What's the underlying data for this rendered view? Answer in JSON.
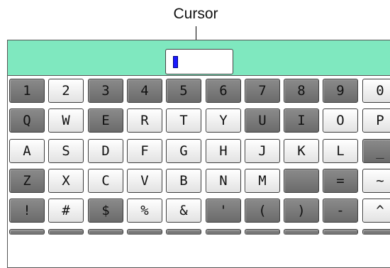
{
  "callout": {
    "label": "Cursor"
  },
  "colors": {
    "top_bar": "#7fe8bf",
    "cursor": "#1a1aff",
    "dark_key": "#777777",
    "light_key": "#f2f2f2"
  },
  "input": {
    "value": ""
  },
  "keyboard": {
    "rows": [
      {
        "keys": [
          {
            "label": "1",
            "style": "dark"
          },
          {
            "label": "2",
            "style": "light"
          },
          {
            "label": "3",
            "style": "dark"
          },
          {
            "label": "4",
            "style": "dark"
          },
          {
            "label": "5",
            "style": "dark"
          },
          {
            "label": "6",
            "style": "dark"
          },
          {
            "label": "7",
            "style": "dark"
          },
          {
            "label": "8",
            "style": "dark"
          },
          {
            "label": "9",
            "style": "dark"
          },
          {
            "label": "0",
            "style": "light"
          }
        ]
      },
      {
        "keys": [
          {
            "label": "Q",
            "style": "dark"
          },
          {
            "label": "W",
            "style": "light"
          },
          {
            "label": "E",
            "style": "dark"
          },
          {
            "label": "R",
            "style": "light"
          },
          {
            "label": "T",
            "style": "light"
          },
          {
            "label": "Y",
            "style": "light"
          },
          {
            "label": "U",
            "style": "dark"
          },
          {
            "label": "I",
            "style": "dark"
          },
          {
            "label": "O",
            "style": "light"
          },
          {
            "label": "P",
            "style": "light"
          }
        ]
      },
      {
        "keys": [
          {
            "label": "A",
            "style": "light"
          },
          {
            "label": "S",
            "style": "light"
          },
          {
            "label": "D",
            "style": "light"
          },
          {
            "label": "F",
            "style": "light"
          },
          {
            "label": "G",
            "style": "light"
          },
          {
            "label": "H",
            "style": "light"
          },
          {
            "label": "J",
            "style": "light"
          },
          {
            "label": "K",
            "style": "light"
          },
          {
            "label": "L",
            "style": "light"
          },
          {
            "label": "_",
            "style": "dark"
          }
        ]
      },
      {
        "keys": [
          {
            "label": "Z",
            "style": "dark"
          },
          {
            "label": "X",
            "style": "light"
          },
          {
            "label": "C",
            "style": "light"
          },
          {
            "label": "V",
            "style": "light"
          },
          {
            "label": "B",
            "style": "light"
          },
          {
            "label": "N",
            "style": "light"
          },
          {
            "label": "M",
            "style": "light"
          },
          {
            "label": "",
            "style": "dark"
          },
          {
            "label": "=",
            "style": "dark"
          },
          {
            "label": "~",
            "style": "light"
          }
        ]
      },
      {
        "keys": [
          {
            "label": "!",
            "style": "dark"
          },
          {
            "label": "#",
            "style": "light"
          },
          {
            "label": "$",
            "style": "dark"
          },
          {
            "label": "%",
            "style": "light"
          },
          {
            "label": "&",
            "style": "light"
          },
          {
            "label": "'",
            "style": "dark"
          },
          {
            "label": "(",
            "style": "dark"
          },
          {
            "label": ")",
            "style": "dark"
          },
          {
            "label": "-",
            "style": "dark"
          },
          {
            "label": "^",
            "style": "light"
          }
        ]
      },
      {
        "keys": [
          {
            "label": "",
            "style": "dark"
          },
          {
            "label": "",
            "style": "dark"
          },
          {
            "label": "",
            "style": "dark"
          },
          {
            "label": "",
            "style": "dark"
          },
          {
            "label": "",
            "style": "dark"
          },
          {
            "label": "",
            "style": "dark"
          },
          {
            "label": "",
            "style": "dark"
          },
          {
            "label": "",
            "style": "dark"
          },
          {
            "label": "",
            "style": "dark"
          },
          {
            "label": "",
            "style": "dark"
          }
        ]
      }
    ]
  }
}
